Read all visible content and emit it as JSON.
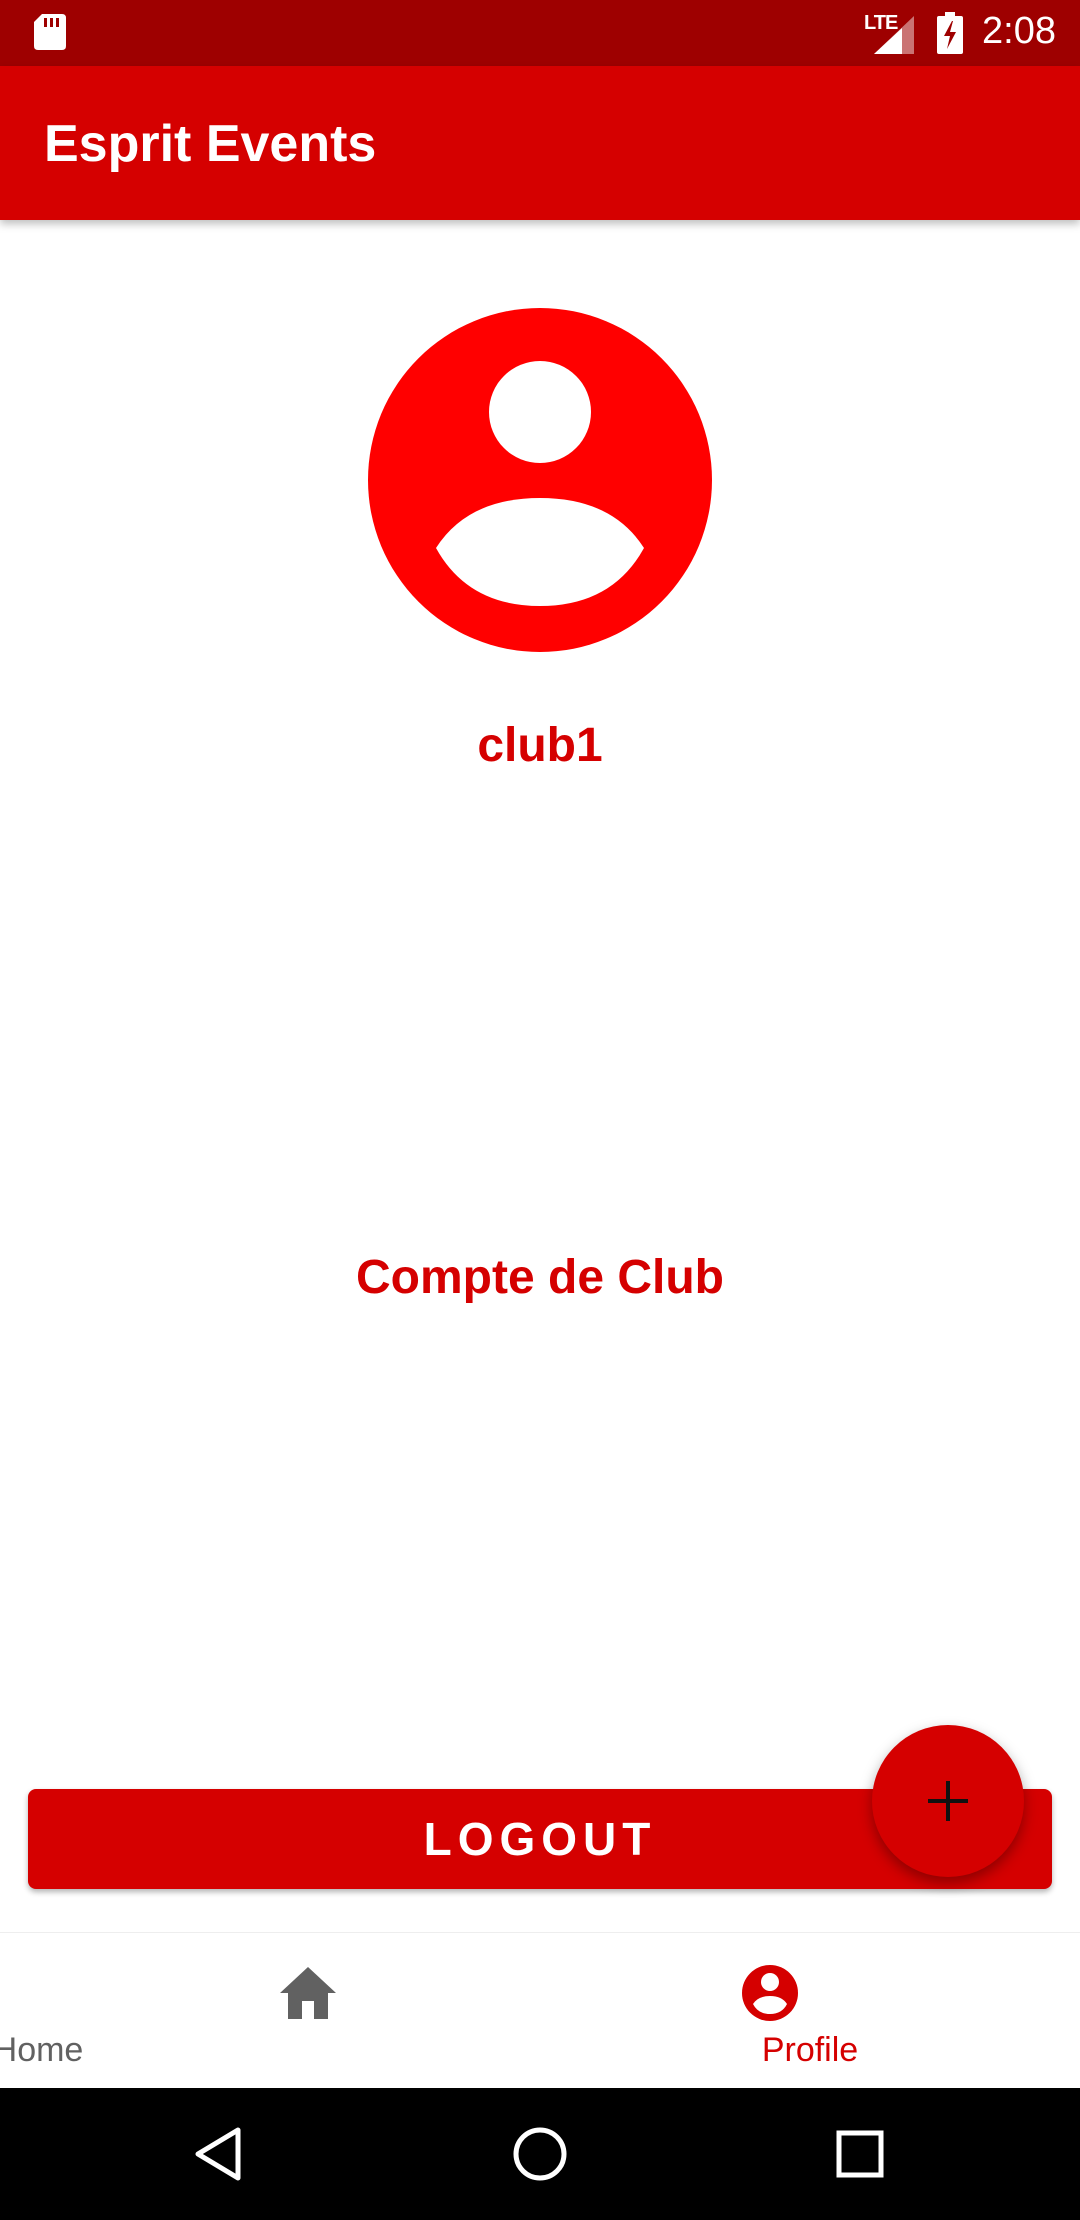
{
  "status_bar": {
    "time": "2:08",
    "network": "LTE",
    "icons": [
      "sd-card-icon",
      "signal-icon",
      "battery-charging-icon"
    ]
  },
  "app_bar": {
    "title": "Esprit Events"
  },
  "profile": {
    "avatar_icon": "account-circle-icon",
    "username": "club1",
    "account_type": "Compte de Club"
  },
  "actions": {
    "logout_label": "LOGOUT",
    "fab_icon": "plus-icon"
  },
  "bottom_nav": {
    "items": [
      {
        "label": "Home",
        "icon": "home-icon",
        "selected": false
      },
      {
        "label": "Profile",
        "icon": "account-circle-icon",
        "selected": true
      }
    ]
  },
  "colors": {
    "status_bar": "#9e0000",
    "primary": "#d50000",
    "avatar": "#ff0000",
    "inactive_nav": "#616161"
  },
  "system_nav": {
    "buttons": [
      "back-icon",
      "home-circle-icon",
      "recents-icon"
    ]
  }
}
